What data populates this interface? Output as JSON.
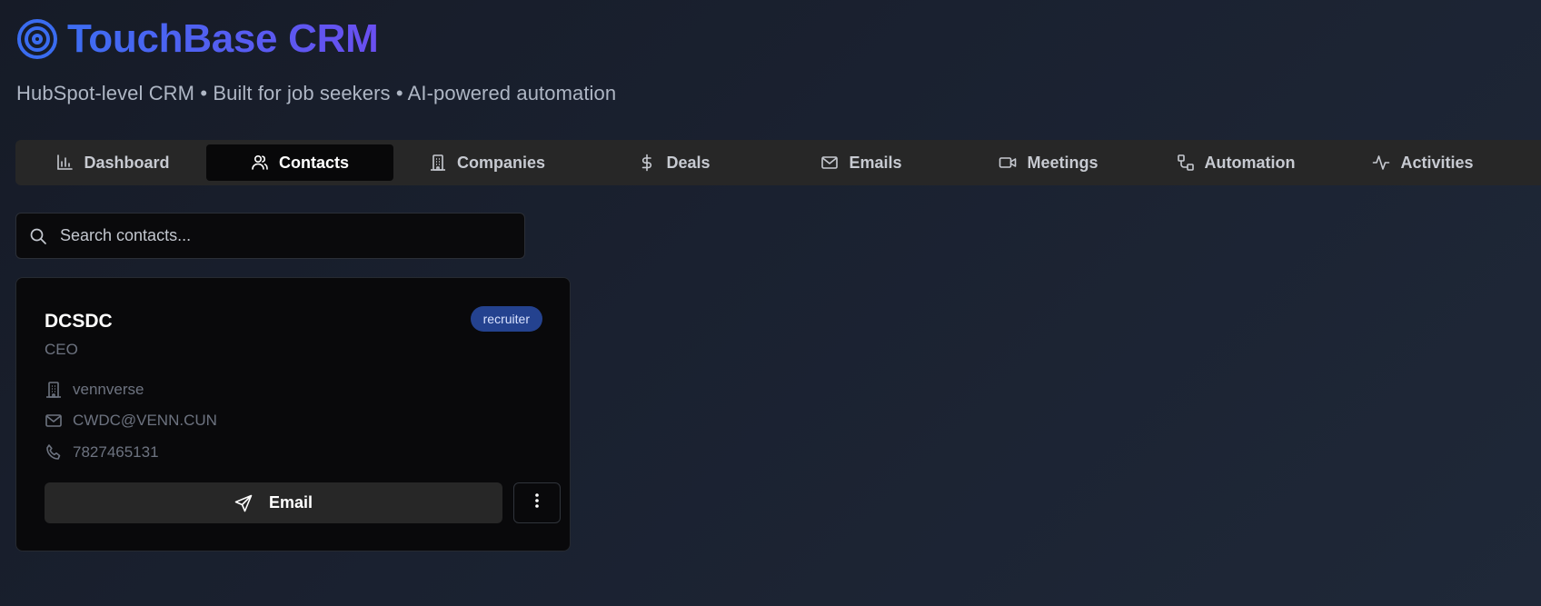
{
  "app": {
    "title": "TouchBase CRM",
    "subtitle": "HubSpot-level CRM • Built for job seekers • AI-powered automation",
    "logo_icon": "target-icon",
    "brand_gradient": [
      "#3d6df2",
      "#6a4ff0"
    ]
  },
  "nav": {
    "active": "Contacts",
    "tabs": [
      {
        "label": "Dashboard",
        "icon": "bar-chart-icon"
      },
      {
        "label": "Contacts",
        "icon": "users-icon"
      },
      {
        "label": "Companies",
        "icon": "building-icon"
      },
      {
        "label": "Deals",
        "icon": "dollar-icon"
      },
      {
        "label": "Emails",
        "icon": "mail-icon"
      },
      {
        "label": "Meetings",
        "icon": "video-icon"
      },
      {
        "label": "Automation",
        "icon": "workflow-icon"
      },
      {
        "label": "Activities",
        "icon": "activity-icon"
      }
    ]
  },
  "search": {
    "placeholder": "Search contacts...",
    "value": "",
    "icon": "search-icon"
  },
  "contact": {
    "name": "DCSDC",
    "title": "CEO",
    "tag": "recruiter",
    "company": "vennverse",
    "email": "CWDC@VENN.CUN",
    "phone": "7827465131",
    "email_button_label": "Email",
    "tag_color": "#24428f"
  }
}
